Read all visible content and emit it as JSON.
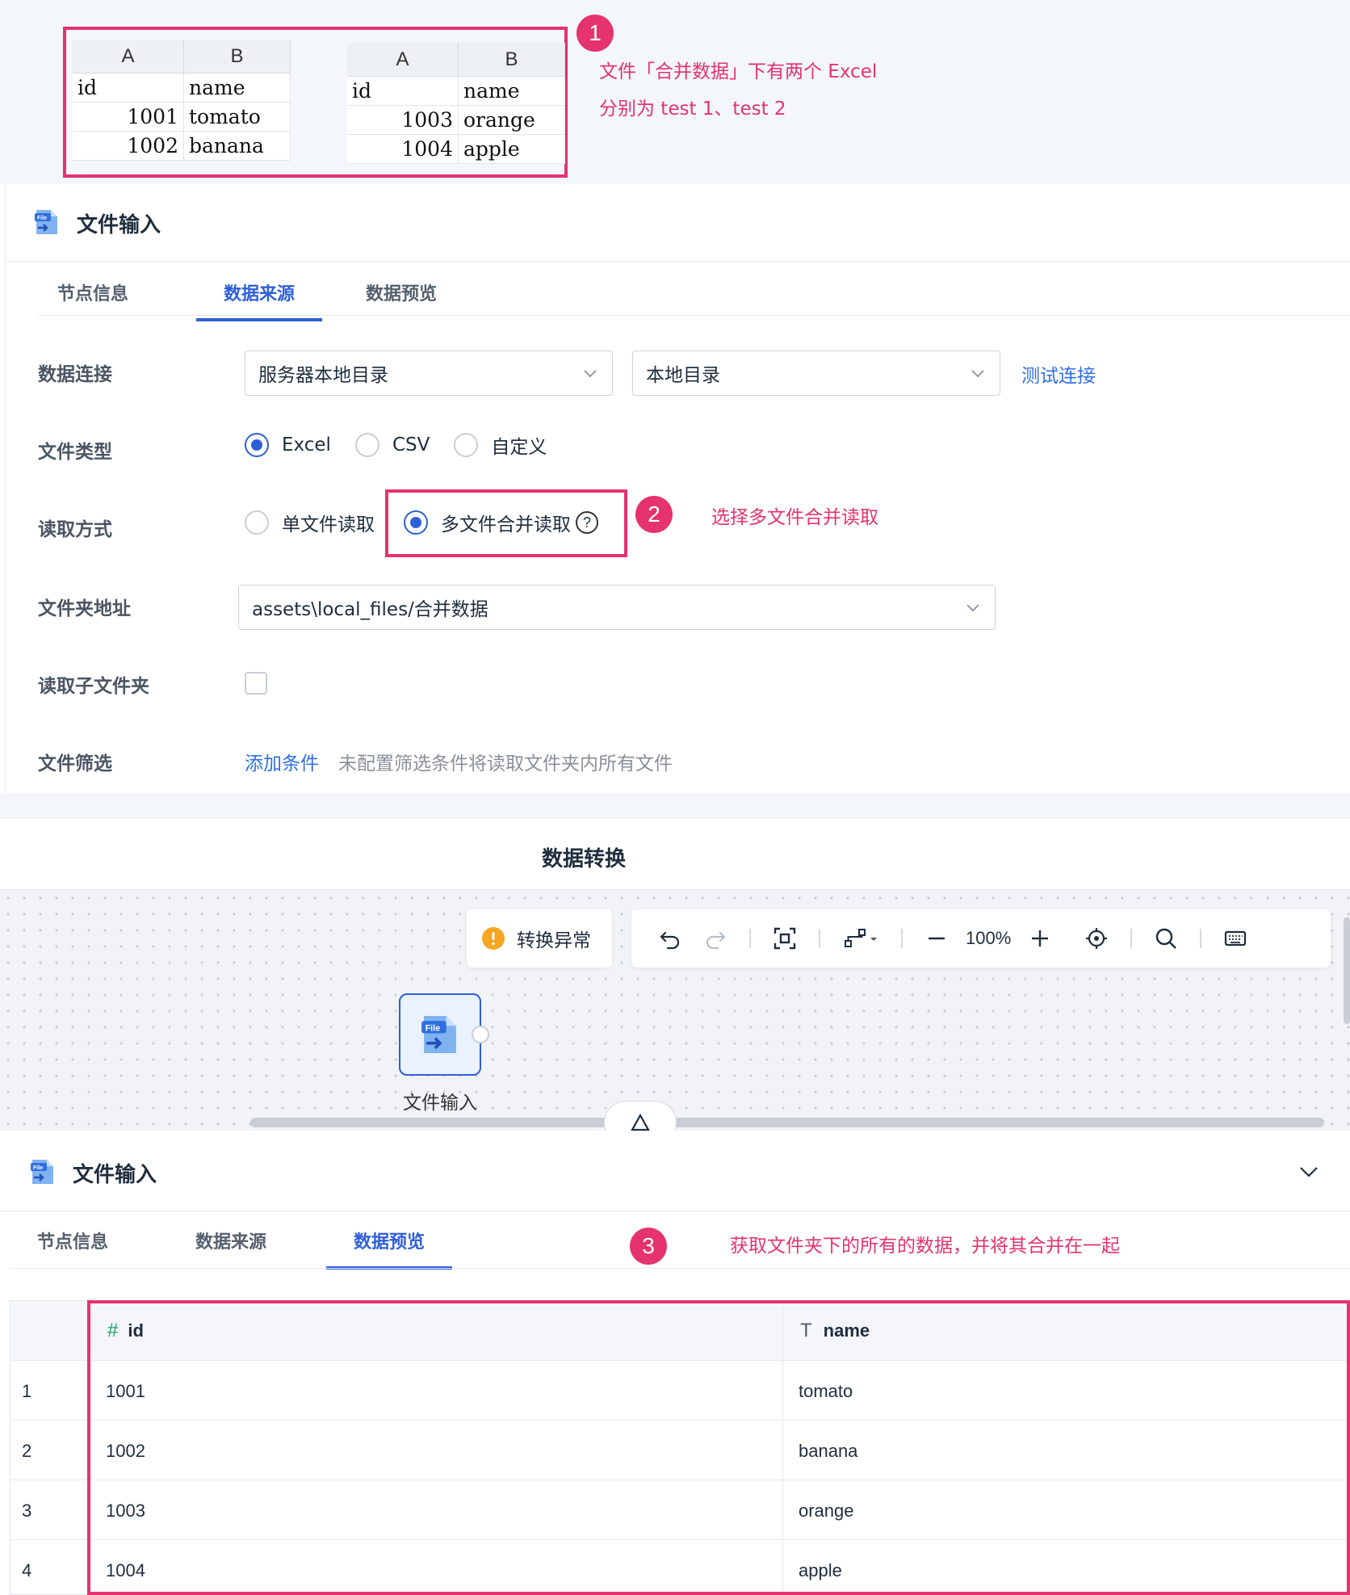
{
  "annotation": {
    "badge1": "1",
    "badge2": "2",
    "badge3": "3",
    "note1_line1": "文件「合并数据」下有两个 Excel",
    "note1_line2": "分别为 test 1、test 2",
    "note2": "选择多文件合并读取",
    "note3": "获取文件夹下的所有的数据，并将其合并在一起"
  },
  "sheets": [
    {
      "columns": [
        "A",
        "B"
      ],
      "rows": [
        [
          "id",
          "name"
        ],
        [
          "1001",
          "tomato"
        ],
        [
          "1002",
          "banana"
        ]
      ]
    },
    {
      "columns": [
        "A",
        "B"
      ],
      "rows": [
        [
          "id",
          "name"
        ],
        [
          "1003",
          "orange"
        ],
        [
          "1004",
          "apple"
        ]
      ]
    }
  ],
  "panel1": {
    "title": "文件输入",
    "tabs": [
      {
        "label": "节点信息"
      },
      {
        "label": "数据来源"
      },
      {
        "label": "数据预览"
      }
    ],
    "active_tab": "数据来源",
    "form": {
      "connection_label": "数据连接",
      "connection_value": "服务器本地目录",
      "directory_value": "本地目录",
      "test_connection": "测试连接",
      "file_type_label": "文件类型",
      "file_types": [
        {
          "label": "Excel",
          "selected": true
        },
        {
          "label": "CSV",
          "selected": false
        },
        {
          "label": "自定义",
          "selected": false
        }
      ],
      "read_mode_label": "读取方式",
      "read_modes": [
        {
          "label": "单文件读取",
          "selected": false
        },
        {
          "label": "多文件合并读取",
          "selected": true
        }
      ],
      "help_glyph": "?",
      "folder_label": "文件夹地址",
      "folder_value": "assets\\local_files/合并数据",
      "subfolder_label": "读取子文件夹",
      "subfolder_checked": false,
      "filter_label": "文件筛选",
      "filter_link": "添加条件",
      "filter_hint": "未配置筛选条件将读取文件夹内所有文件"
    }
  },
  "transform": {
    "title": "数据转换",
    "error_label": "转换异常",
    "zoom": "100%",
    "node_label": "文件输入"
  },
  "panel2": {
    "title": "文件输入",
    "tabs": [
      {
        "label": "节点信息"
      },
      {
        "label": "数据来源"
      },
      {
        "label": "数据预览"
      }
    ],
    "active_tab": "数据预览",
    "table": {
      "columns": [
        {
          "name": "id",
          "type_icon": "hash-icon",
          "glyph": "#"
        },
        {
          "name": "name",
          "type_icon": "text-type-icon",
          "glyph": "T"
        }
      ],
      "rows": [
        {
          "index": "1",
          "id": "1001",
          "name": "tomato"
        },
        {
          "index": "2",
          "id": "1002",
          "name": "banana"
        },
        {
          "index": "3",
          "id": "1003",
          "name": "orange"
        },
        {
          "index": "4",
          "id": "1004",
          "name": "apple"
        }
      ]
    }
  },
  "colors": {
    "accent": "#2f5fd6",
    "annotation": "#e5336f",
    "link": "#2f6fe0"
  }
}
